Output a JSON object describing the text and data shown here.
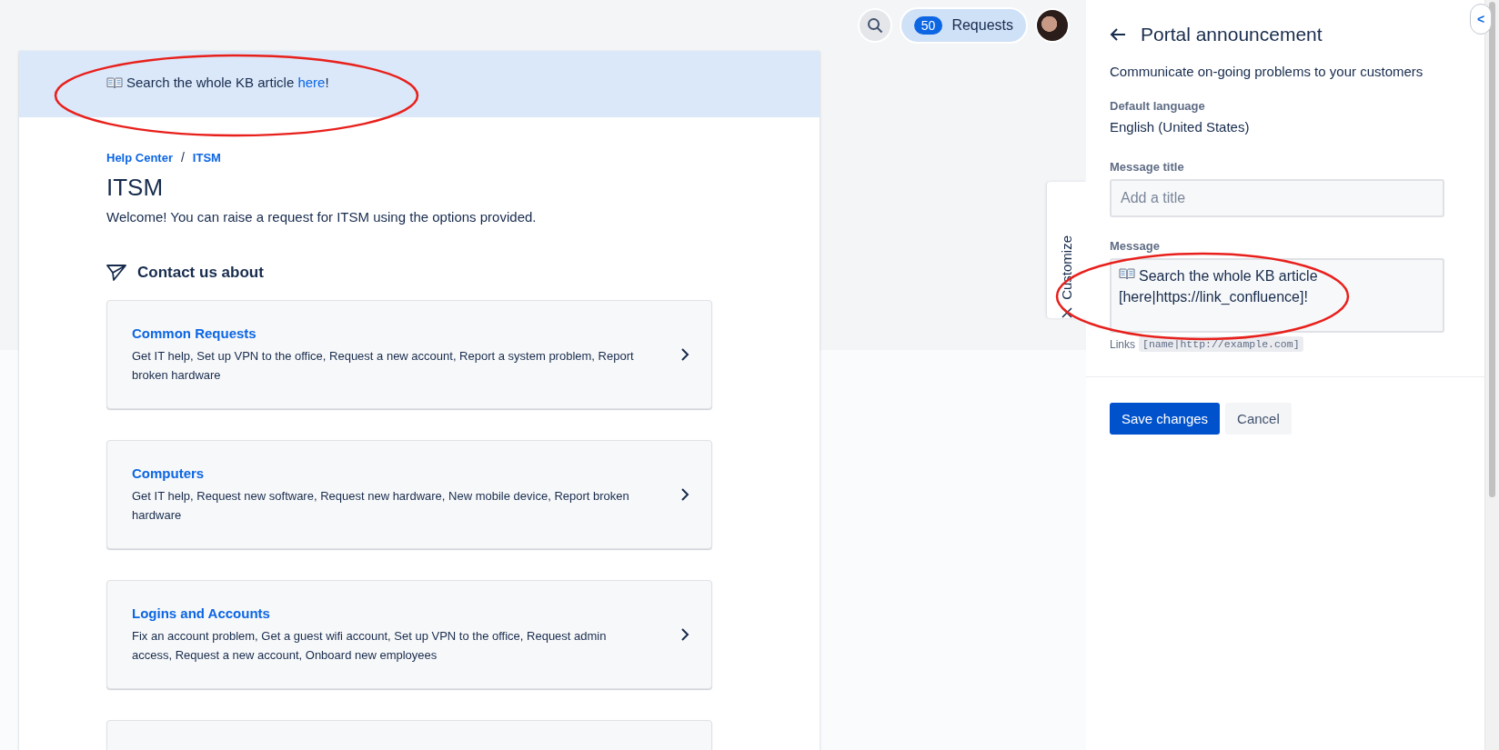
{
  "top_bar": {
    "requests_count": "50",
    "requests_label": "Requests"
  },
  "banner": {
    "text": "Search the whole KB article ",
    "link": "here",
    "suffix": "!"
  },
  "breadcrumb": {
    "items": [
      "Help Center",
      "ITSM"
    ],
    "separator": "/"
  },
  "title": "ITSM",
  "welcome": "Welcome! You can raise a request for ITSM using the options provided.",
  "section_title": "Contact us about",
  "cards": [
    {
      "kind": "full",
      "title": "Common Requests",
      "description": "Get IT help, Set up VPN to the office, Request a new account, Report a system problem, Report broken hardware"
    },
    {
      "kind": "full",
      "title": "Computers",
      "description": "Get IT help, Request new software, Request new hardware, New mobile device, Report broken hardware"
    },
    {
      "kind": "full",
      "title": "Logins and Accounts",
      "description": "Fix an account problem, Get a guest wifi account, Set up VPN to the office, Request admin access, Request a new account, Onboard new employees"
    },
    {
      "kind": "cut"
    }
  ],
  "customize_tab": "Customize",
  "collapse_button": "<",
  "panel": {
    "title": "Portal announcement",
    "subtitle": "Communicate on-going problems to your customers",
    "default_language_label": "Default language",
    "default_language": "English (United States)",
    "message_title": {
      "label": "Message title",
      "placeholder": "Add a title"
    },
    "message": {
      "label": "Message",
      "lines": [
        "Search the whole KB article",
        "[here|https://link_confluence]!"
      ]
    },
    "hint": {
      "label": "Links",
      "code": "[name|http://example.com]"
    },
    "buttons": [
      {
        "label": "Save changes",
        "kind": "primary"
      },
      {
        "label": "Cancel",
        "kind": "subtle"
      }
    ]
  }
}
